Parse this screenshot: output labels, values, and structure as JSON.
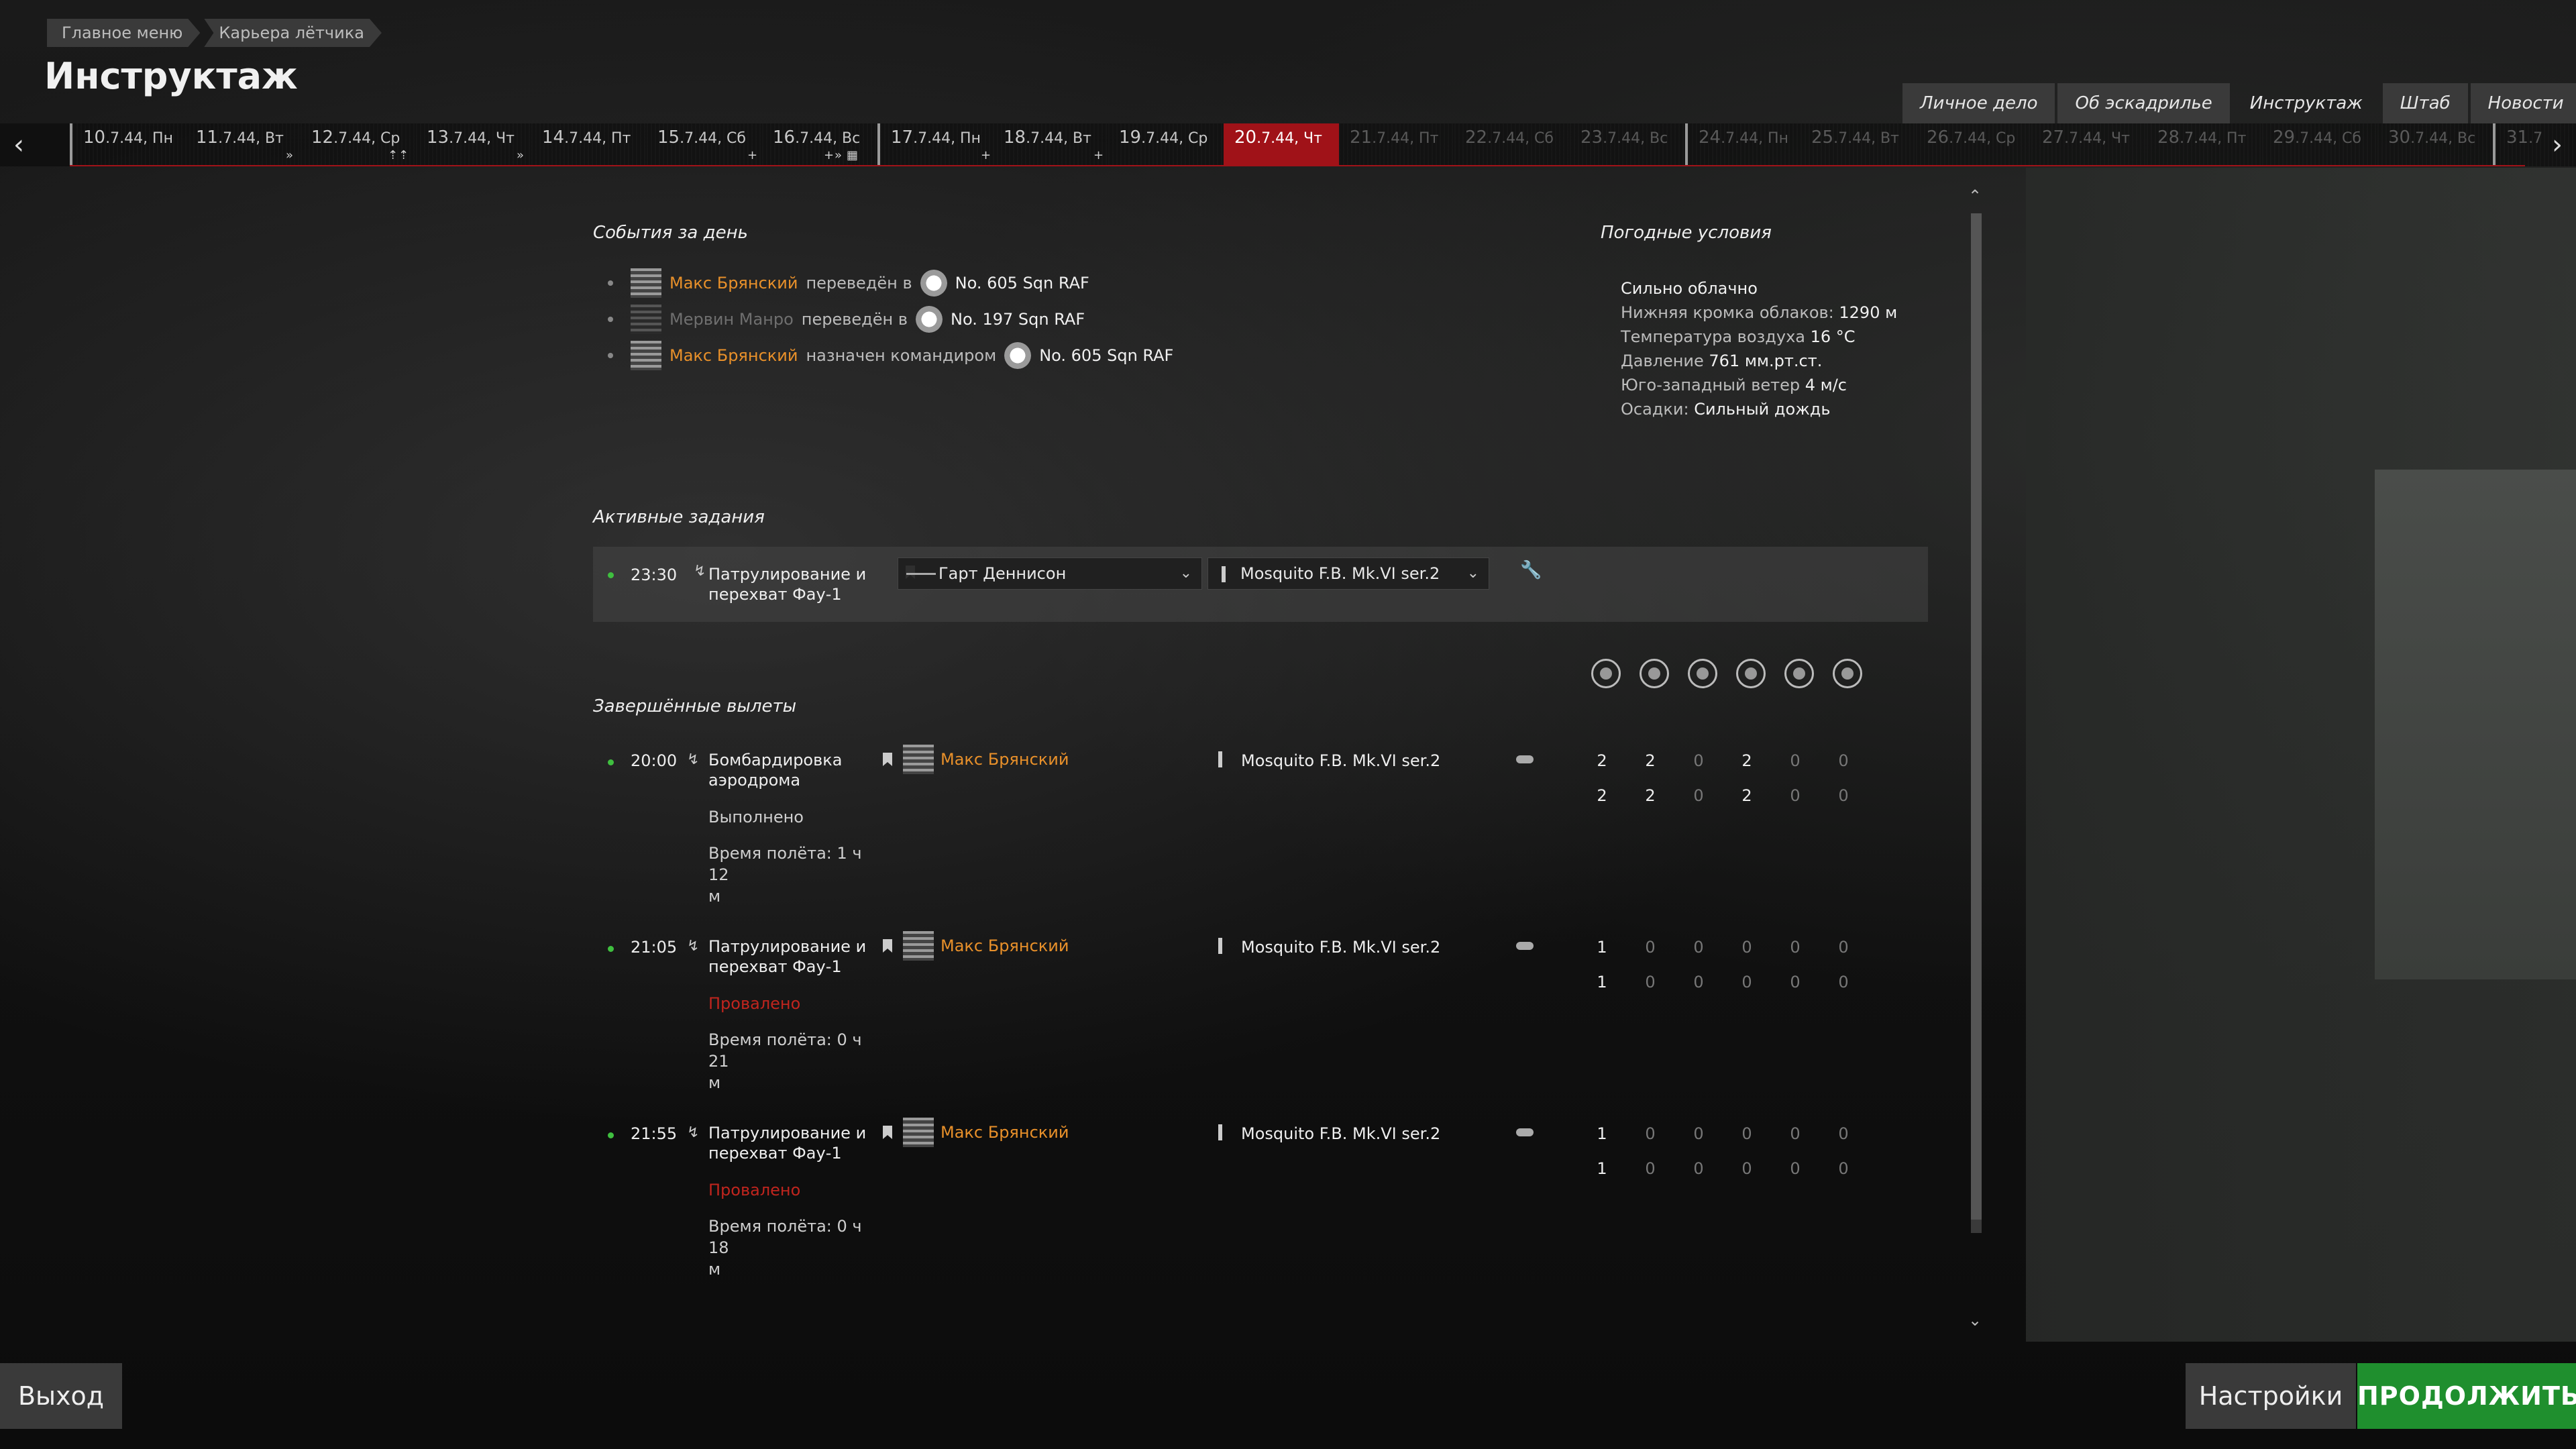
{
  "breadcrumb": [
    "Главное меню",
    "Карьера лётчика"
  ],
  "title": "Инструктаж",
  "tabs": [
    {
      "label": "Личное дело"
    },
    {
      "label": "Об эскадрилье"
    },
    {
      "label": "Инструктаж"
    },
    {
      "label": "Штаб"
    },
    {
      "label": "Новости"
    }
  ],
  "dates": [
    {
      "day": "10",
      "rest": ".7.44, Пн"
    },
    {
      "day": "11",
      "rest": ".7.44, Вт"
    },
    {
      "day": "12",
      "rest": ".7.44, Ср"
    },
    {
      "day": "13",
      "rest": ".7.44, Чт"
    },
    {
      "day": "14",
      "rest": ".7.44, Пт"
    },
    {
      "day": "15",
      "rest": ".7.44, Сб"
    },
    {
      "day": "16",
      "rest": ".7.44, Вс"
    },
    {
      "day": "17",
      "rest": ".7.44, Пн"
    },
    {
      "day": "18",
      "rest": ".7.44, Вт"
    },
    {
      "day": "19",
      "rest": ".7.44, Ср"
    },
    {
      "day": "20",
      "rest": ".7.44, Чт"
    },
    {
      "day": "21",
      "rest": ".7.44, Пт"
    },
    {
      "day": "22",
      "rest": ".7.44, Сб"
    },
    {
      "day": "23",
      "rest": ".7.44, Вс"
    },
    {
      "day": "24",
      "rest": ".7.44, Пн"
    },
    {
      "day": "25",
      "rest": ".7.44, Вт"
    },
    {
      "day": "26",
      "rest": ".7.44, Ср"
    },
    {
      "day": "27",
      "rest": ".7.44, Чт"
    },
    {
      "day": "28",
      "rest": ".7.44, Пт"
    },
    {
      "day": "29",
      "rest": ".7.44, Сб"
    },
    {
      "day": "30",
      "rest": ".7.44, Вс"
    },
    {
      "day": "31",
      "rest": ".7"
    }
  ],
  "date_markers": {
    "ff": "»",
    "plus": "+",
    "up": "⇡",
    "cal": "▦"
  },
  "events": {
    "title": "События за день",
    "items": [
      {
        "pilot": "Макс Брянский",
        "action": "переведён в",
        "squadron": "No. 605 Sqn RAF"
      },
      {
        "pilot": "Мервин Манро",
        "action": "переведён в",
        "squadron": "No. 197 Sqn RAF"
      },
      {
        "pilot": "Макс Брянский",
        "action": "назначен командиром",
        "squadron": "No. 605 Sqn RAF"
      }
    ]
  },
  "weather": {
    "title": "Погодные условия",
    "lines": [
      {
        "label": "Сильно облачно",
        "value": ""
      },
      {
        "label": "Нижняя кромка облаков: ",
        "value": "1290 м"
      },
      {
        "label": "Температура воздуха ",
        "value": "16 °C"
      },
      {
        "label": "Давление ",
        "value": "761 мм.рт.ст."
      },
      {
        "label": "Юго-западный ветер ",
        "value": "4 м/с"
      },
      {
        "label": "Осадки: ",
        "value": "Сильный дождь"
      }
    ]
  },
  "active": {
    "title": "Активные задания",
    "task": {
      "time": "23:30",
      "mission_line1": "Патрулирование и",
      "mission_line2": "перехват Фау-1",
      "pilot_select": "Гарт Деннисон",
      "aircraft_select": "Mosquito F.B. Mk.VI ser.2"
    }
  },
  "completed": {
    "title": "Завершённые вылеты",
    "sorties": [
      {
        "time": "20:00",
        "mission_line1": "Бомбардировка",
        "mission_line2": "аэродрома",
        "status": "Выполнено",
        "status_kind": "ok",
        "flytime_line1": "Время полёта: 1 ч 12",
        "flytime_line2": "м",
        "pilot": "Макс Брянский",
        "aircraft": "Mosquito F.B. Mk.VI ser.2",
        "row1": [
          "2",
          "2",
          "0",
          "2",
          "0",
          "0"
        ],
        "row2": [
          "2",
          "2",
          "0",
          "2",
          "0",
          "0"
        ]
      },
      {
        "time": "21:05",
        "mission_line1": "Патрулирование и",
        "mission_line2": "перехват Фау-1",
        "status": "Провалено",
        "status_kind": "fail",
        "flytime_line1": "Время полёта: 0 ч 21",
        "flytime_line2": "м",
        "pilot": "Макс Брянский",
        "aircraft": "Mosquito F.B. Mk.VI ser.2",
        "row1": [
          "1",
          "0",
          "0",
          "0",
          "0",
          "0"
        ],
        "row2": [
          "1",
          "0",
          "0",
          "0",
          "0",
          "0"
        ]
      },
      {
        "time": "21:55",
        "mission_line1": "Патрулирование и",
        "mission_line2": "перехват Фау-1",
        "status": "Провалено",
        "status_kind": "fail",
        "flytime_line1": "Время полёта: 0 ч 18",
        "flytime_line2": "м",
        "pilot": "Макс Брянский",
        "aircraft": "Mosquito F.B. Mk.VI ser.2",
        "row1": [
          "1",
          "0",
          "0",
          "0",
          "0",
          "0"
        ],
        "row2": [
          "1",
          "0",
          "0",
          "0",
          "0",
          "0"
        ]
      }
    ]
  },
  "buttons": {
    "exit": "Выход",
    "settings": "Настройки",
    "continue": "ПРОДОЛЖИТЬ"
  },
  "icons": {
    "prev": "‹",
    "next": "›",
    "chevron": "⌄",
    "scroll_up": "⌃",
    "scroll_down": "⌄",
    "wrench": "🔧"
  },
  "colors": {
    "active_date": "#a01218",
    "pilot": "#e8902a",
    "fail": "#c0251e",
    "continue": "#1f8f2e"
  }
}
